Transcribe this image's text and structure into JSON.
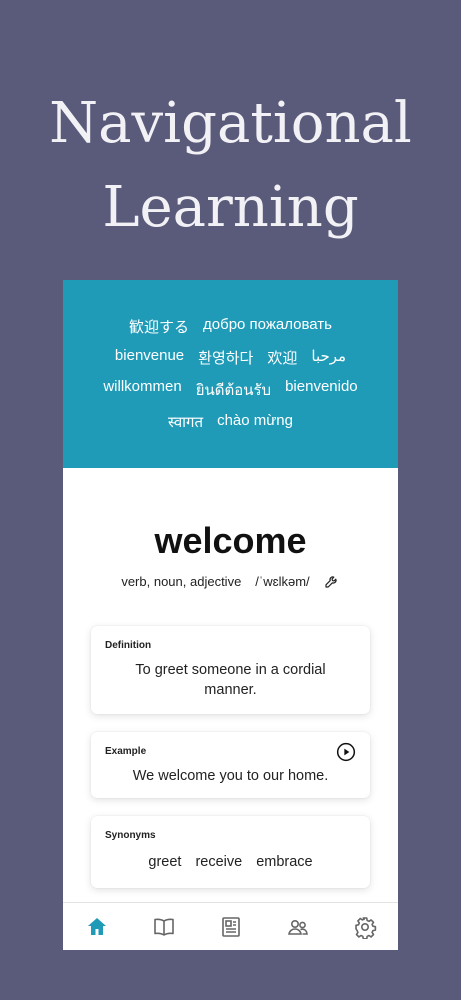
{
  "headline": {
    "line1": "Navigational",
    "line2": "Learning"
  },
  "greetings": {
    "rows": [
      [
        "歓迎する",
        "добро пожаловать"
      ],
      [
        "bienvenue",
        "환영하다",
        "欢迎",
        "مرحبا"
      ],
      [
        "willkommen",
        "ยินดีต้อนรับ",
        "bienvenido"
      ],
      [
        "स्वागत",
        "chào mừng"
      ]
    ]
  },
  "entry": {
    "word": "welcome",
    "part_of_speech": "verb, noun, adjective",
    "pronunciation": "/ˈwɛlkəm/",
    "wrench_icon": "wrench-icon"
  },
  "definition": {
    "label": "Definition",
    "text": "To greet someone in a cordial manner."
  },
  "example": {
    "label": "Example",
    "text": "We welcome you to our home.",
    "play_icon": "play-circle-icon"
  },
  "synonyms": {
    "label": "Synonyms",
    "items": [
      "greet",
      "receive",
      "embrace"
    ]
  },
  "tabbar": {
    "active_color": "#1f9bb8",
    "inactive_color": "#666666",
    "items": [
      "home-icon",
      "book-icon",
      "newspaper-icon",
      "people-icon",
      "gear-icon"
    ],
    "active_index": 0
  },
  "colors": {
    "background": "#5a5a7a",
    "banner": "#1f9bb8"
  }
}
